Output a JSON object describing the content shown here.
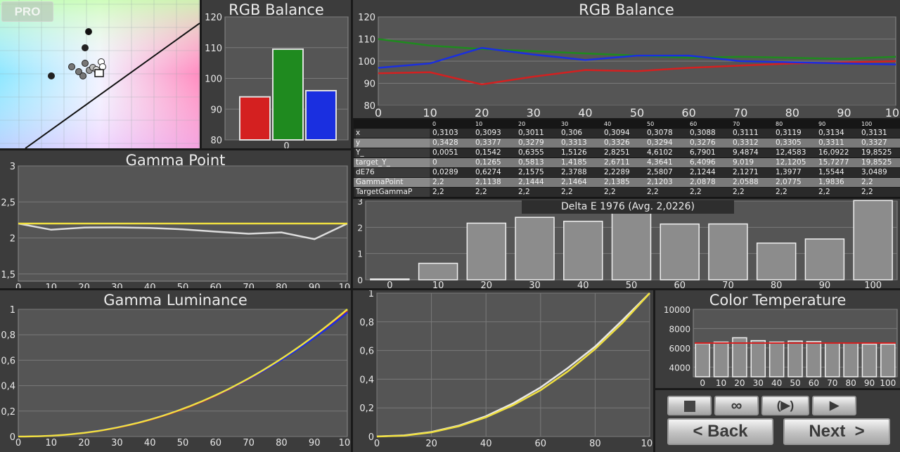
{
  "badge": "PRO",
  "rgb_small": {
    "title": "RGB Balance",
    "y_ticks": [
      "120",
      "110",
      "100",
      "90",
      "80"
    ],
    "x_label": "0"
  },
  "rgb_line": {
    "title": "RGB Balance",
    "y_ticks": [
      "120",
      "110",
      "100",
      "90",
      "80"
    ],
    "x_ticks": [
      "0",
      "10",
      "20",
      "30",
      "40",
      "50",
      "60",
      "70",
      "80",
      "90",
      "100"
    ]
  },
  "gamma_point": {
    "title": "Gamma Point",
    "y_ticks": [
      "3",
      "2,5",
      "2",
      "1,5"
    ],
    "x_ticks": [
      "0",
      "10",
      "20",
      "30",
      "40",
      "50",
      "60",
      "70",
      "80",
      "90",
      "100"
    ]
  },
  "gamma_lum": {
    "title": "Gamma Luminance",
    "y_ticks": [
      "1",
      "0,8",
      "0,6",
      "0,4",
      "0,2",
      "0"
    ],
    "x_ticks": [
      "0",
      "10",
      "20",
      "30",
      "40",
      "50",
      "60",
      "70",
      "80",
      "90",
      "100"
    ]
  },
  "gamma_curve": {
    "y_ticks": [
      "1",
      "0,8",
      "0,6",
      "0,4",
      "0,2",
      "0"
    ],
    "x_ticks": [
      "0",
      "20",
      "40",
      "60",
      "80",
      "100"
    ]
  },
  "delta_e": {
    "title": "Delta E 1976 (Avg. 2,0226)",
    "y_ticks": [
      "3",
      "2",
      "1",
      "0"
    ],
    "x_ticks": [
      "0",
      "10",
      "20",
      "30",
      "40",
      "50",
      "60",
      "70",
      "80",
      "90",
      "100"
    ]
  },
  "color_temp": {
    "title": "Color Temperature",
    "y_ticks": [
      "10000",
      "8000",
      "6000",
      "4000"
    ],
    "x_ticks": [
      "0",
      "10",
      "20",
      "30",
      "40",
      "50",
      "60",
      "70",
      "80",
      "90",
      "100"
    ]
  },
  "table": {
    "header": [
      "0",
      "10",
      "20",
      "30",
      "40",
      "50",
      "60",
      "70",
      "80",
      "90",
      "100"
    ],
    "rows": [
      {
        "label": "x",
        "values": [
          "0,3103",
          "0,3093",
          "0,3011",
          "0,306",
          "0,3094",
          "0,3078",
          "0,3088",
          "0,3111",
          "0,3119",
          "0,3134",
          "0,3131"
        ]
      },
      {
        "label": "y",
        "values": [
          "0,3428",
          "0,3377",
          "0,3279",
          "0,3313",
          "0,3326",
          "0,3294",
          "0,3276",
          "0,3312",
          "0,3305",
          "0,3311",
          "0,3327"
        ]
      },
      {
        "label": "Y_",
        "values": [
          "0,0051",
          "0,1542",
          "0,6355",
          "1,5126",
          "2,8251",
          "4,6102",
          "6,7901",
          "9,4874",
          "12,4583",
          "16,0922",
          "19,8525"
        ]
      },
      {
        "label": "target_Y_",
        "values": [
          "0",
          "0,1265",
          "0,5813",
          "1,4185",
          "2,6711",
          "4,3641",
          "6,4096",
          "9,019",
          "12,1205",
          "15,7277",
          "19,8525"
        ]
      },
      {
        "label": "dE76",
        "values": [
          "0,0289",
          "0,6274",
          "2,1575",
          "2,3788",
          "2,2289",
          "2,5807",
          "2,1244",
          "2,1271",
          "1,3977",
          "1,5544",
          "3,0489"
        ]
      },
      {
        "label": "GammaPoint",
        "values": [
          "2,2",
          "2,1138",
          "2,1444",
          "2,1464",
          "2,1385",
          "2,1203",
          "2,0878",
          "2,0588",
          "2,0775",
          "1,9836",
          "2,2"
        ]
      },
      {
        "label": "TargetGammaP",
        "values": [
          "2,2",
          "2,2",
          "2,2",
          "2,2",
          "2,2",
          "2,2",
          "2,2",
          "2,2",
          "2,2",
          "2,2",
          "2,2"
        ]
      }
    ]
  },
  "controls": {
    "stop_icon": "stop-icon",
    "loop_icon": "infinity-icon",
    "autoplay_icon": "auto-play-icon",
    "play_icon": "play-icon",
    "loop_glyph": "∞",
    "autoplay_glyph": "(▶)",
    "play_glyph": "▶",
    "back_label": "< Back",
    "next_label": "Next  >"
  },
  "colors": {
    "red": "#d42020",
    "green": "#1f8a1f",
    "blue": "#1a2fe0",
    "yellow": "#f0e040",
    "bar_gray": "#8c8c8c"
  },
  "chart_data": [
    {
      "type": "scatter",
      "name": "cie-gamut",
      "points": [
        [
          0.313,
          0.329
        ]
      ],
      "note_target": "white point"
    },
    {
      "type": "bar",
      "title": "RGB Balance",
      "categories": [
        "R",
        "G",
        "B"
      ],
      "x": [
        "0"
      ],
      "values": [
        94,
        109.5,
        96
      ],
      "ylim": [
        80,
        120
      ]
    },
    {
      "type": "line",
      "title": "RGB Balance",
      "x": [
        0,
        10,
        20,
        30,
        40,
        50,
        60,
        70,
        80,
        90,
        100
      ],
      "ylim": [
        80,
        120
      ],
      "series": [
        {
          "color": "#d42020",
          "values": [
            94.5,
            95,
            89.5,
            93,
            96,
            95.5,
            97,
            98,
            99,
            99.5,
            100
          ]
        },
        {
          "color": "#1f8a1f",
          "values": [
            110,
            107,
            105.5,
            104.5,
            103.5,
            102.5,
            101.5,
            102,
            101.5,
            101,
            102
          ]
        },
        {
          "color": "#1a2fe0",
          "values": [
            97,
            99,
            106,
            103,
            100.5,
            102.5,
            102.5,
            100,
            99.5,
            99,
            98.5
          ]
        }
      ]
    },
    {
      "type": "line",
      "title": "Gamma Point",
      "x": [
        0,
        10,
        20,
        30,
        40,
        50,
        60,
        70,
        80,
        90,
        100
      ],
      "ylim": [
        1.4,
        3
      ],
      "series": [
        {
          "name": "GammaPoint",
          "values": [
            2.2,
            2.1138,
            2.1444,
            2.1464,
            2.1385,
            2.1203,
            2.0878,
            2.0588,
            2.0775,
            1.9836,
            2.2
          ]
        },
        {
          "name": "TargetGammaP",
          "values": [
            2.2,
            2.2,
            2.2,
            2.2,
            2.2,
            2.2,
            2.2,
            2.2,
            2.2,
            2.2,
            2.2
          ]
        }
      ]
    },
    {
      "type": "bar",
      "title": "Delta E 1976 (Avg. 2,0226)",
      "categories": [
        "0",
        "10",
        "20",
        "30",
        "40",
        "50",
        "60",
        "70",
        "80",
        "90",
        "100"
      ],
      "values": [
        0.0289,
        0.6274,
        2.1575,
        2.3788,
        2.2289,
        2.5807,
        2.1244,
        2.1271,
        1.3977,
        1.5544,
        3.0489
      ],
      "ylim": [
        0,
        3
      ]
    },
    {
      "type": "line",
      "title": "Gamma Luminance",
      "x": [
        0,
        10,
        20,
        30,
        40,
        50,
        60,
        70,
        80,
        90,
        100
      ],
      "ylim": [
        0,
        1
      ],
      "gamma": 2.2
    },
    {
      "type": "line",
      "name": "gamma-luminance-curve",
      "x": [
        0,
        10,
        20,
        30,
        40,
        50,
        60,
        70,
        80,
        90,
        100
      ],
      "ylim": [
        0,
        1
      ],
      "series": [
        {
          "name": "Y_",
          "values": [
            0.0003,
            0.0078,
            0.032,
            0.0762,
            0.1423,
            0.2322,
            0.342,
            0.4779,
            0.6275,
            0.8106,
            1
          ]
        },
        {
          "name": "target_Y_",
          "values": [
            0,
            0.0064,
            0.0293,
            0.0715,
            0.1345,
            0.2198,
            0.3229,
            0.4543,
            0.6105,
            0.7922,
            1
          ]
        }
      ]
    },
    {
      "type": "bar",
      "title": "Color Temperature",
      "categories": [
        "0",
        "10",
        "20",
        "30",
        "40",
        "50",
        "60",
        "70",
        "80",
        "90",
        "100"
      ],
      "values": [
        6450,
        6600,
        7050,
        6750,
        6600,
        6700,
        6650,
        6500,
        6500,
        6400,
        6400
      ],
      "reference": 6500,
      "ylim": [
        3000,
        10000
      ]
    }
  ]
}
